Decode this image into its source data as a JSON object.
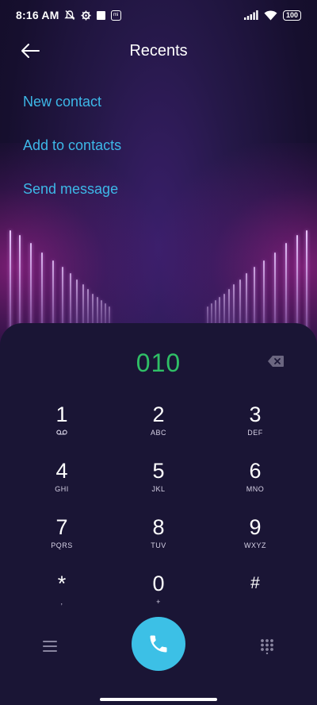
{
  "status_bar": {
    "time": "8:16 AM",
    "battery": "100",
    "icons": [
      "mute-icon",
      "settings-icon",
      "square-notification-icon",
      "mi-badge-icon",
      "signal-icon",
      "wifi-icon",
      "battery-icon"
    ]
  },
  "header": {
    "title": "Recents",
    "back_icon": "back-arrow-icon"
  },
  "menu": {
    "new_contact": "New contact",
    "add_to_contacts": "Add to contacts",
    "send_message": "Send message"
  },
  "dialpad": {
    "number": "010",
    "keys": [
      {
        "digit": "1",
        "letters": ""
      },
      {
        "digit": "2",
        "letters": "ABC"
      },
      {
        "digit": "3",
        "letters": "DEF"
      },
      {
        "digit": "4",
        "letters": "GHI"
      },
      {
        "digit": "5",
        "letters": "JKL"
      },
      {
        "digit": "6",
        "letters": "MNO"
      },
      {
        "digit": "7",
        "letters": "PQRS"
      },
      {
        "digit": "8",
        "letters": "TUV"
      },
      {
        "digit": "9",
        "letters": "WXYZ"
      },
      {
        "digit": "*",
        "letters": ","
      },
      {
        "digit": "0",
        "letters": "+"
      },
      {
        "digit": "#",
        "letters": ""
      }
    ]
  },
  "colors": {
    "accent_blue": "#3db8e8",
    "number_green": "#2fbf66",
    "call_button": "#3cc0e6",
    "sheet": "#1a1535"
  }
}
